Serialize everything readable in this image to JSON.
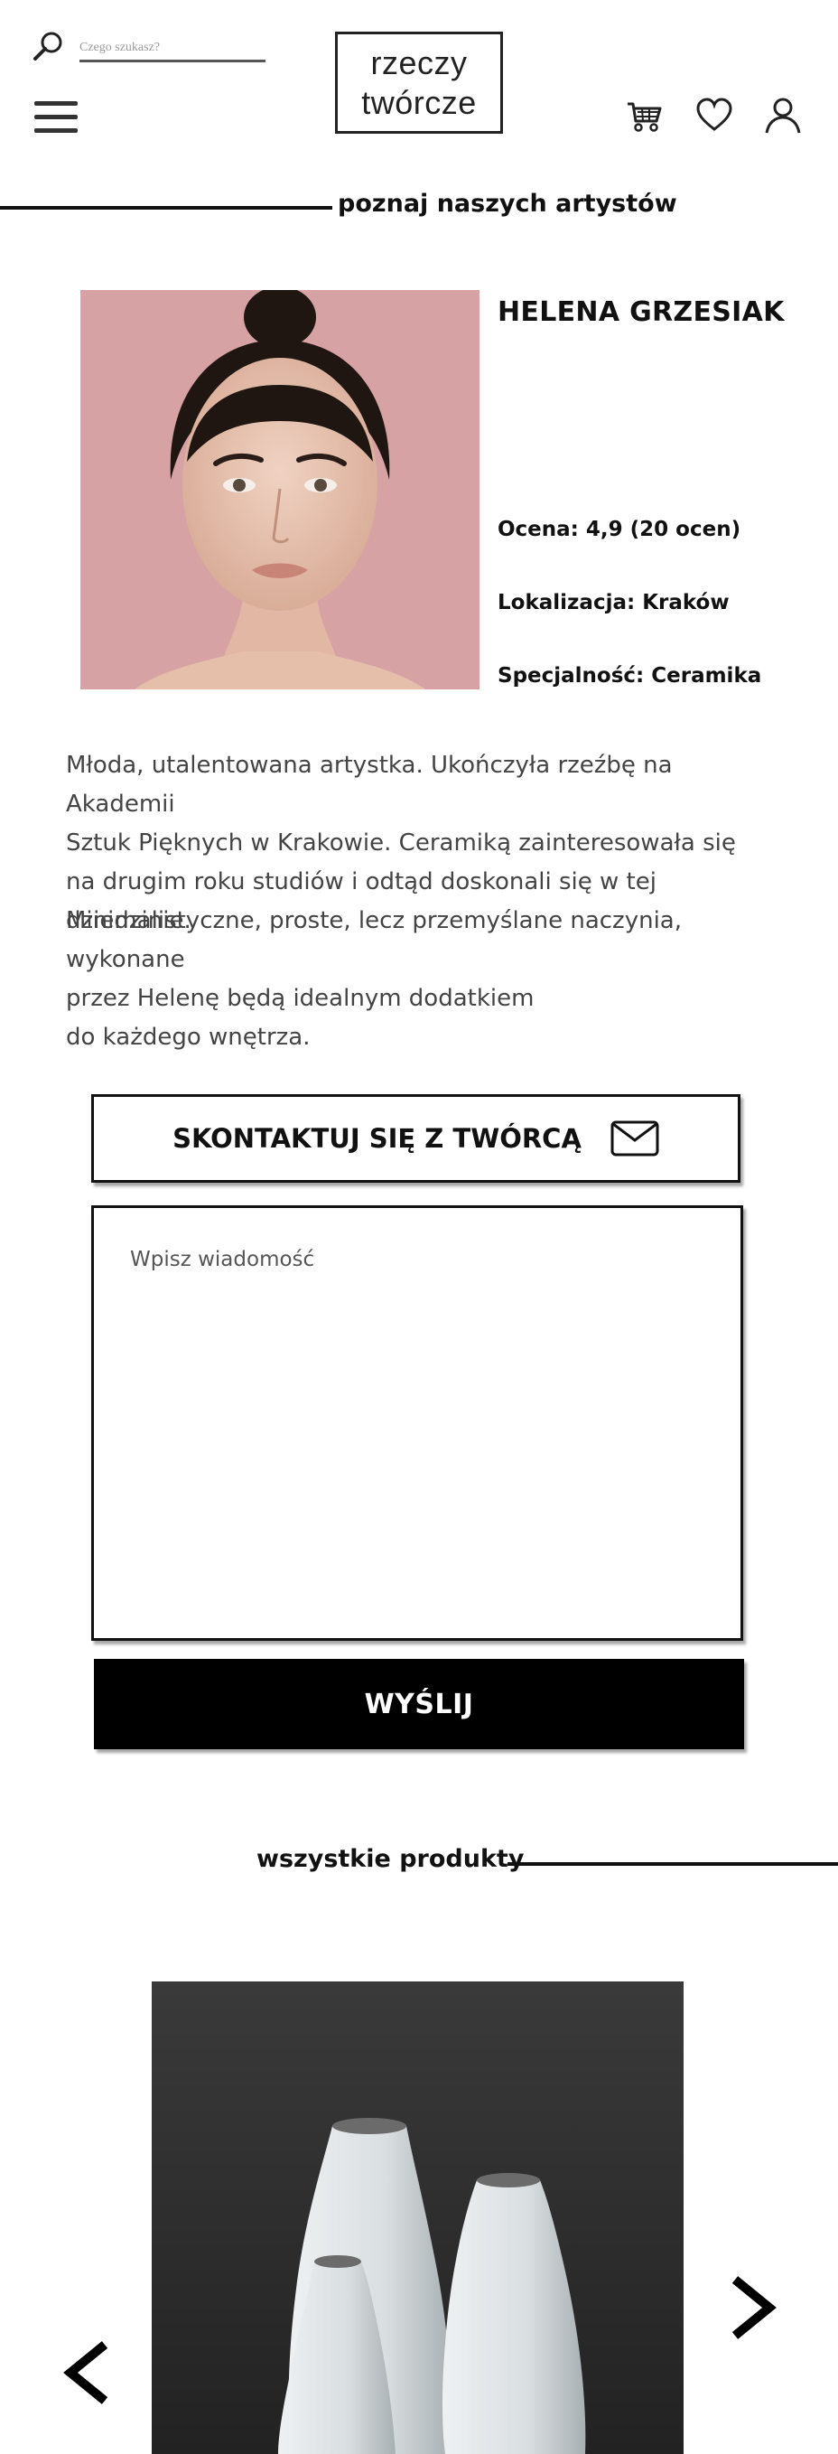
{
  "header": {
    "search_placeholder": "Czego szukasz?",
    "logo_line1": "rzeczy",
    "logo_line2": "twórcze"
  },
  "artists_section": {
    "title": "poznaj naszych artystów"
  },
  "artist": {
    "name": "HELENA GRZESIAK",
    "rating": "Ocena: 4,9 (20 ocen)",
    "location": "Lokalizacja: Kraków",
    "specialty": "Specjalność: Ceramika",
    "bio_paragraph_1": [
      "Młoda, utalentowana artystka. Ukończyła rzeźbę na Akademii",
      "Sztuk Pięknych w Krakowie. Ceramiką zainteresowała się",
      "na drugim roku studiów i odtąd doskonali się w tej dziedzinie."
    ],
    "bio_paragraph_2": [
      "Minimalistyczne, proste, lecz przemyślane naczynia, wykonane",
      "przez Helenę będą idealnym dodatkiem",
      "do każdego wnętrza."
    ]
  },
  "contact": {
    "button_label": "SKONTAKTUJ SIĘ Z TWÓRCĄ",
    "message_placeholder": "Wpisz wiadomość",
    "send_label": "WYŚLIJ"
  },
  "products_section": {
    "title": "wszystkie produkty"
  },
  "icons": {
    "search": "search-icon",
    "menu": "hamburger-menu-icon",
    "cart": "cart-icon",
    "favorites": "heart-icon",
    "account": "user-icon",
    "mail": "envelope-icon",
    "prev": "chevron-left-icon",
    "next": "chevron-right-icon"
  },
  "colors": {
    "text": "#111111",
    "body_text": "#444444",
    "photo_bg": "#d7a2a4",
    "product_bg": "#2b2b2b",
    "button_bg": "#000000",
    "button_text": "#ffffff"
  }
}
